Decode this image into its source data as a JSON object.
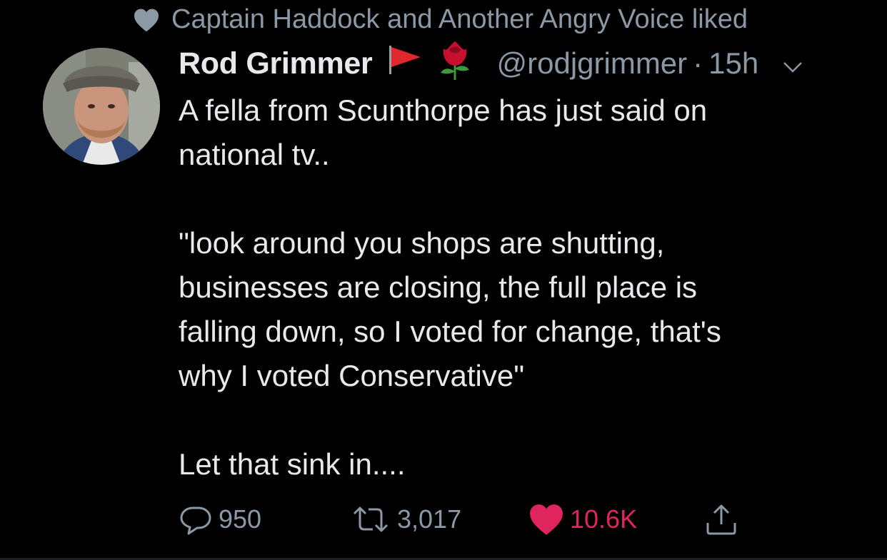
{
  "social_context": {
    "text": "Captain Haddock and Another Angry Voice liked",
    "icon": "heart-icon"
  },
  "tweet": {
    "author": {
      "display_name": "Rod Grimmer",
      "emoji": [
        "red-flag-icon",
        "red-rose-icon"
      ],
      "handle": "@rodjgrimmer",
      "avatar": "avatar-photo"
    },
    "separator": "·",
    "time": "15h",
    "text": "A fella from Scunthorpe has just said on\nnational tv..\n\n\"look around you shops are shutting,\nbusinesses are closing, the full place is\nfalling down, so I voted for change, that's\nwhy I voted Conservative\"\n\nLet that sink in....",
    "actions": {
      "replies": "950",
      "retweets": "3,017",
      "likes": "10.6K"
    }
  },
  "colors": {
    "background": "#000000",
    "text": "#e7e9ea",
    "secondary_text": "#8b98a5",
    "like": "#e0245e"
  }
}
